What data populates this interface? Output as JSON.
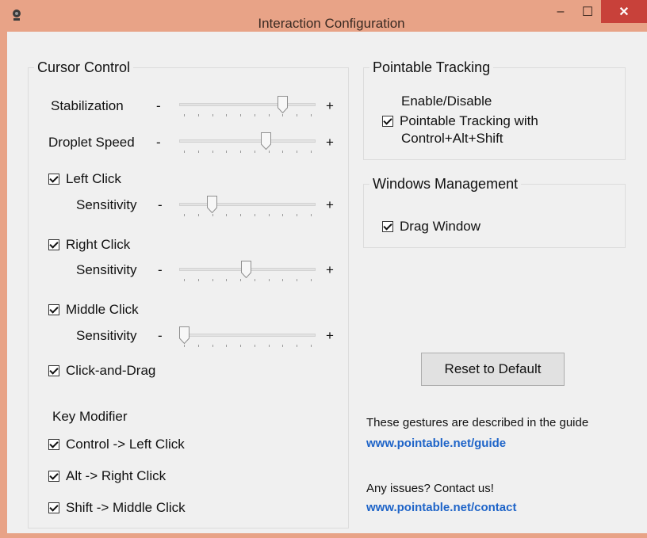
{
  "window": {
    "title": "Interaction Configuration",
    "minimize_glyph": "–",
    "maximize_glyph": "☐",
    "close_glyph": "✕",
    "accent_color": "#e8a387",
    "close_color": "#c8413a"
  },
  "cursor_control": {
    "title": "Cursor Control",
    "minus": "-",
    "plus": "+",
    "stabilization": {
      "label": "Stabilization",
      "value": 0.78
    },
    "droplet_speed": {
      "label": "Droplet Speed",
      "value": 0.65
    },
    "left_click": {
      "label": "Left Click",
      "checked": true,
      "sensitivity_label": "Sensitivity",
      "value": 0.22
    },
    "right_click": {
      "label": "Right Click",
      "checked": true,
      "sensitivity_label": "Sensitivity",
      "value": 0.49
    },
    "middle_click": {
      "label": "Middle Click",
      "checked": true,
      "sensitivity_label": "Sensitivity",
      "value": 0.0
    },
    "click_and_drag": {
      "label": "Click-and-Drag",
      "checked": true
    },
    "key_modifier_title": "Key Modifier",
    "modifiers": [
      {
        "label": "Control -> Left Click",
        "checked": true
      },
      {
        "label": "Alt -> Right Click",
        "checked": true
      },
      {
        "label": "Shift -> Middle Click",
        "checked": true
      }
    ]
  },
  "pointable_tracking": {
    "title": "Pointable Tracking",
    "line1": "Enable/Disable",
    "line2": "Pointable Tracking with",
    "line3": "Control+Alt+Shift",
    "checked": true
  },
  "windows_management": {
    "title": "Windows Management",
    "drag_window": {
      "label": "Drag Window",
      "checked": true
    }
  },
  "reset_button": "Reset to Default",
  "guide_text": "These gestures are described in the guide",
  "guide_link": "www.pointable.net/guide",
  "contact_text": "Any issues? Contact us!",
  "contact_link": "www.pointable.net/contact",
  "link_color": "#1e64c8"
}
